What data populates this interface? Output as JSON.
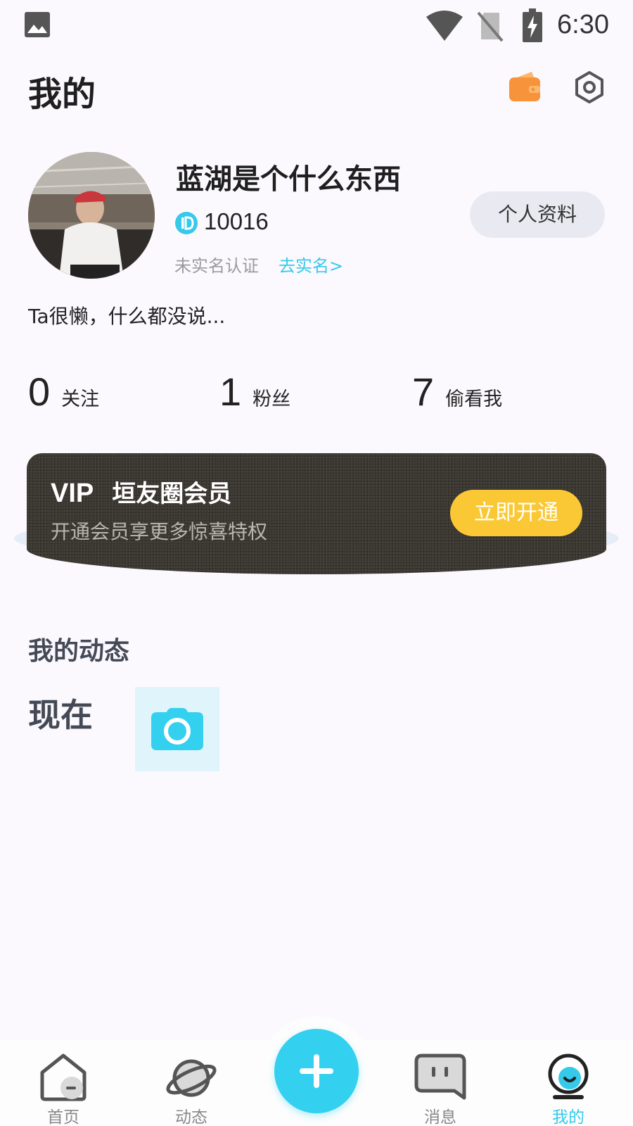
{
  "status_bar": {
    "time": "6:30",
    "icons": [
      "gallery-icon",
      "wifi-icon",
      "no-sim-icon",
      "battery-charging-icon"
    ]
  },
  "header": {
    "title": "我的",
    "icons": [
      "wallet-icon",
      "settings-icon"
    ]
  },
  "profile": {
    "username": "蓝湖是个什么东西",
    "id_number": "10016",
    "verify_status": "未实名认证",
    "verify_link": "去实名>",
    "profile_button": "个人资料",
    "bio": "Ta很懒，什么都没说..."
  },
  "stats": [
    {
      "value": "0",
      "label": "关注"
    },
    {
      "value": "1",
      "label": "粉丝"
    },
    {
      "value": "7",
      "label": "偷看我"
    }
  ],
  "vip": {
    "label": "VIP",
    "name": "垣友圈会员",
    "subtitle": "开通会员享更多惊喜特权",
    "cta": "立即开通"
  },
  "posts": {
    "section_title": "我的动态",
    "date_label": "现在"
  },
  "bottom_nav": {
    "items": [
      {
        "label": "首页",
        "icon": "home-icon"
      },
      {
        "label": "动态",
        "icon": "planet-icon"
      },
      {
        "label": "消息",
        "icon": "message-icon"
      },
      {
        "label": "我的",
        "icon": "profile-face-icon"
      }
    ],
    "active": "我的",
    "post_button_icon": "plus-icon"
  },
  "colors": {
    "accent": "#35c9ea",
    "vip_button": "#fbc835",
    "wallet": "#f7933a",
    "background": "#fbf9fe"
  }
}
